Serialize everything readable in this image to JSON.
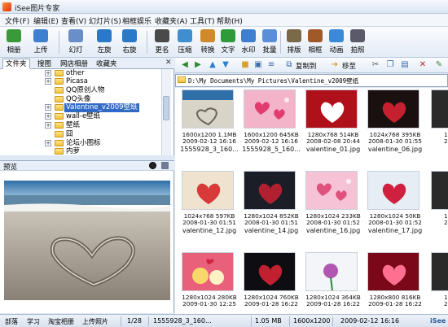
{
  "window": {
    "title": "iSee图片专家"
  },
  "menu": [
    "文件(F)",
    "编辑(E)",
    "查看(V)",
    "幻灯片(S)",
    "相框娱乐",
    "收藏夹(A)",
    "工具(T)",
    "帮助(H)"
  ],
  "toolbar": {
    "buttons": [
      {
        "label": "相册",
        "icon": "album-icon",
        "color": "#3a9a3a"
      },
      {
        "label": "上传",
        "icon": "upload-icon",
        "color": "#3f7fd0"
      },
      {
        "label": "幻灯",
        "icon": "slideshow-icon",
        "color": "#6a8fc8"
      },
      {
        "label": "左旋",
        "icon": "rotate-left-icon",
        "color": "#2a78c8"
      },
      {
        "label": "右旋",
        "icon": "rotate-right-icon",
        "color": "#2a78c8"
      },
      {
        "label": "更名",
        "icon": "rename-icon",
        "color": "#4a4a4a"
      },
      {
        "label": "压缩",
        "icon": "compress-icon",
        "color": "#3f8fd0"
      },
      {
        "label": "转换",
        "icon": "convert-icon",
        "color": "#d08a2a"
      },
      {
        "label": "文字",
        "icon": "text-icon",
        "color": "#2f9a3a"
      },
      {
        "label": "水印",
        "icon": "watermark-icon",
        "color": "#3f7fd0"
      },
      {
        "label": "批量",
        "icon": "batch-icon",
        "color": "#5a8fd8"
      },
      {
        "label": "排版",
        "icon": "layout-icon",
        "color": "#7a6a4a"
      },
      {
        "label": "相框",
        "icon": "frame-icon",
        "color": "#a05a2a"
      },
      {
        "label": "动画",
        "icon": "animation-icon",
        "color": "#3a8ad8"
      },
      {
        "label": "拍照",
        "icon": "camera-icon",
        "color": "#5a5a6a"
      }
    ]
  },
  "left_tabs": [
    "文件夹",
    "搜图",
    "网店相册",
    "收藏夹"
  ],
  "tree": [
    {
      "label": "other",
      "selected": false
    },
    {
      "label": "Picasa",
      "selected": false
    },
    {
      "label": "QQ原创人物",
      "selected": false
    },
    {
      "label": "QQ头像",
      "selected": false
    },
    {
      "label": "Valentine_v2009壁纸",
      "selected": true
    },
    {
      "label": "wall-e壁纸",
      "selected": false
    },
    {
      "label": "壁纸",
      "selected": false
    },
    {
      "label": "囧",
      "selected": false
    },
    {
      "label": "论坛小图标",
      "selected": false
    },
    {
      "label": "内萝",
      "selected": false
    }
  ],
  "preview": {
    "label": "预览"
  },
  "nav": {
    "copy_label": "复制到",
    "move_label": "移至"
  },
  "path": "D:\\My Documents\\My Pictures\\Valentine_v2009壁纸",
  "thumbnails": [
    {
      "meta1": "1600x1200  1.1MB",
      "meta2": "2009-02-12 16:16",
      "name": "1555928_3_160...",
      "bg": "#7e8fa3",
      "accent": "#d9d4c8",
      "type": "beach"
    },
    {
      "meta1": "1600x1200  645KB",
      "meta2": "2009-02-12 16:16",
      "name": "1555928_5_160...",
      "bg": "#f3b3c9",
      "accent": "#e23b6f",
      "type": "hearts"
    },
    {
      "meta1": "1280x768  514KB",
      "meta2": "2008-02-08 20:44",
      "name": "valentine_01.jpg",
      "bg": "#b0101a",
      "accent": "#ffffff",
      "type": "heart"
    },
    {
      "meta1": "1024x768  395KB",
      "meta2": "2008-01-30 01:55",
      "name": "valentine_06.jpg",
      "bg": "#1a1010",
      "accent": "#c42030",
      "type": "heart"
    },
    {
      "meta1": "1024x768  597KB",
      "meta2": "2008-01-30 01:51",
      "name": "valentine_12.jpg",
      "bg": "#efe3cf",
      "accent": "#d83a3a",
      "type": "heart"
    },
    {
      "meta1": "1280x1024  852KB",
      "meta2": "2008-01-30 01:51",
      "name": "valentine_14.jpg",
      "bg": "#1b1e26",
      "accent": "#b02030",
      "type": "heart"
    },
    {
      "meta1": "1280x1024  233KB",
      "meta2": "2008-01-30 01:52",
      "name": "valentine_16.jpg",
      "bg": "#f6c3d6",
      "accent": "#e0527e",
      "type": "hearts"
    },
    {
      "meta1": "1280x1024  50KB",
      "meta2": "2008-01-30 01:52",
      "name": "valentine_17.jpg",
      "bg": "#e7edf4",
      "accent": "#d02040",
      "type": "heart"
    },
    {
      "meta1": "1280x1024  280KB",
      "meta2": "2009-01-30 12:25",
      "name": "",
      "bg": "#e9607a",
      "accent": "#f8d86a",
      "type": "cute"
    },
    {
      "meta1": "1280x1024  760KB",
      "meta2": "2009-01-28 16:22",
      "name": "",
      "bg": "#0d0d12",
      "accent": "#c02030",
      "type": "heart"
    },
    {
      "meta1": "1280x1024  364KB",
      "meta2": "2009-01-28 16:22",
      "name": "",
      "bg": "#f4f5f8",
      "accent": "#a030a0",
      "type": "flower"
    },
    {
      "meta1": "1280x800  816KB",
      "meta2": "2009-01-28 16:22",
      "name": "",
      "bg": "#7a0818",
      "accent": "#ff6f8f",
      "type": "heart"
    }
  ],
  "thumb_partial": [
    {
      "meta1": "1600",
      "meta2": "2009-"
    },
    {
      "meta1": "1280",
      "meta2": "2009-"
    },
    {
      "meta1": "1280",
      "meta2": "2009-"
    }
  ],
  "status": {
    "items": [
      "部落",
      "学习",
      "淘宝相册",
      "上传照片"
    ],
    "count": "1/28",
    "file": "1555928_3_160...",
    "size": "1.05 MB",
    "dims": "1600x1200",
    "date": "2009-02-12 16:16",
    "brand": "iSee"
  }
}
